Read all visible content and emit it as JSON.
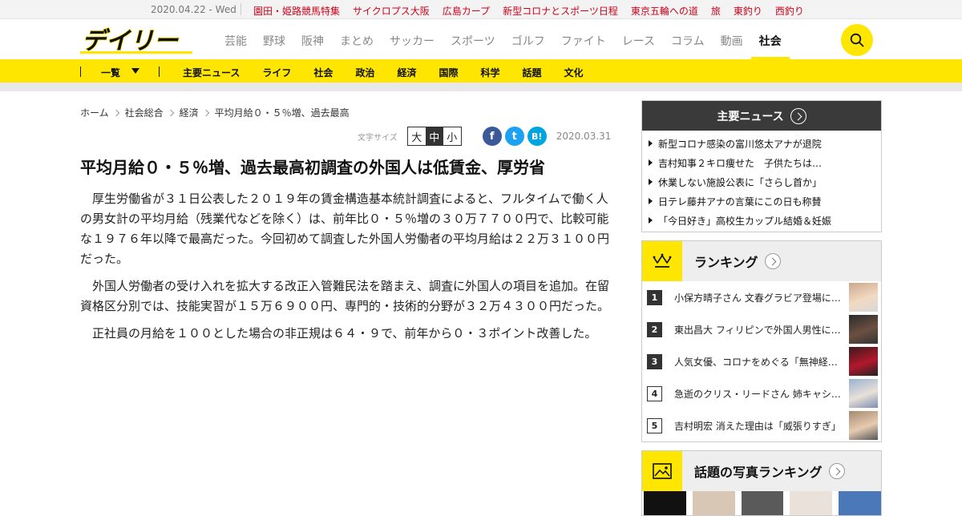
{
  "topbar": {
    "date": "2020.04.22 - Wed",
    "links": [
      "園田・姫路競馬特集",
      "サイクロプス大阪",
      "広島カープ",
      "新型コロナとスポーツ日程",
      "東京五輪への道",
      "旅",
      "東釣り",
      "西釣り"
    ]
  },
  "header": {
    "logo_text": "デイリー",
    "nav": [
      "芸能",
      "野球",
      "阪神",
      "まとめ",
      "サッカー",
      "スポーツ",
      "ゴルフ",
      "ファイト",
      "レース",
      "コラム",
      "動画",
      "社会"
    ],
    "active_nav": "社会",
    "search_icon": "search-icon"
  },
  "subnav": {
    "all_label": "一覧",
    "links": [
      "主要ニュース",
      "ライフ",
      "社会",
      "政治",
      "経済",
      "国際",
      "科学",
      "話題",
      "文化"
    ]
  },
  "breadcrumb": [
    "ホーム",
    "社会総合",
    "経済",
    "平均月給０・５％増、過去最高"
  ],
  "tools": {
    "font_size_label": "文字サイズ",
    "sizes": [
      "大",
      "中",
      "小"
    ],
    "selected_size": "中",
    "share": [
      "f",
      "t",
      "B!"
    ],
    "date": "2020.03.31"
  },
  "article": {
    "title": "平均月給０・５％増、過去最高初調査の外国人は低賃金、厚労省",
    "paragraphs": [
      "厚生労働省が３１日公表した２０１９年の賃金構造基本統計調査によると、フルタイムで働く人の男女計の平均月給（残業代などを除く）は、前年比０・５％増の３０万７７００円で、比較可能な１９７６年以降で最高だった。今回初めて調査した外国人労働者の平均月給は２２万３１００円だった。",
      "外国人労働者の受け入れを拡大する改正入管難民法を踏まえ、調査に外国人の項目を追加。在留資格区分別では、技能実習が１５万６９００円、専門的・技術的分野が３２万４３００円だった。",
      "正社員の月給を１００とした場合の非正規は６４・９で、前年から０・３ポイント改善した。"
    ]
  },
  "sidebar": {
    "main_news": {
      "heading": "主要ニュース",
      "items": [
        "新型コロナ感染の富川悠太アナが退院",
        "吉村知事２キロ痩せた　子供たちは…",
        "休業しない施設公表に「さらし首か」",
        "日テレ藤井アナの言葉にこの日も称賛",
        "「今日好き」高校生カップル結婚＆妊娠"
      ]
    },
    "ranking": {
      "heading": "ランキング",
      "items": [
        {
          "rank": "1",
          "text": "小保方晴子さん 文春グラビア登場に…"
        },
        {
          "rank": "2",
          "text": "東出昌大 フィリピンで外国人男性に…"
        },
        {
          "rank": "3",
          "text": "人気女優、コロナをめぐる「無神経」…"
        },
        {
          "rank": "4",
          "text": "急逝のクリス・リードさん 姉キャシ…"
        },
        {
          "rank": "5",
          "text": "吉村明宏 消えた理由は「威張りすぎ」"
        }
      ]
    },
    "photo_ranking": {
      "heading": "話題の写真ランキング"
    }
  },
  "colors": {
    "brand_yellow": "#ffe600",
    "accent_red": "#d0021b",
    "dark_header": "#3a3a3a"
  }
}
